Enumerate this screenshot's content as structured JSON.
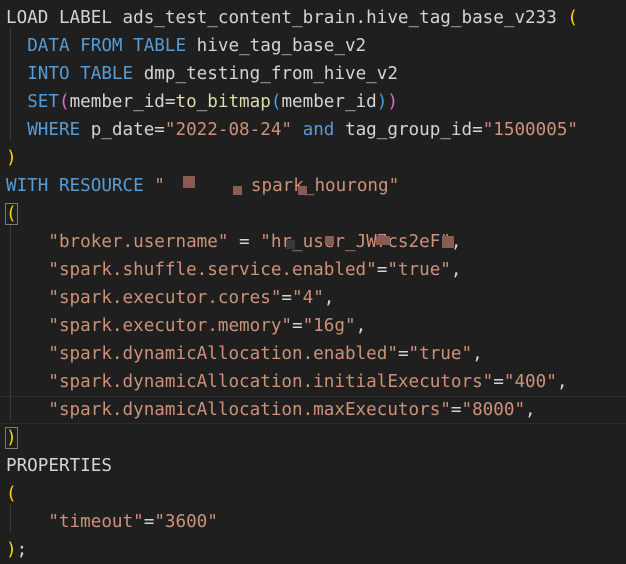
{
  "editor": {
    "line1": {
      "kw": "LOAD LABEL",
      "text": " ads_test_content_brain.hive_tag_base_v233 ",
      "paren": "("
    },
    "line2": {
      "kw": "DATA FROM TABLE",
      "text": " hive_tag_base_v2"
    },
    "line3": {
      "kw": "INTO TABLE",
      "text": " dmp_testing_from_hive_v2"
    },
    "line4": {
      "kw": "SET",
      "paren_open": "(",
      "text1": "member_id=",
      "fn": "to_bitmap",
      "paren_inner_open": "(",
      "text2": "member_id",
      "paren_inner_close": ")",
      "paren_close": ")"
    },
    "line5": {
      "kw": "WHERE",
      "text1": " p_date=",
      "str1": "\"2022-08-24\"",
      "kw2": " and",
      "text2": " tag_group_id=",
      "str2": "\"1500005\""
    },
    "line6": {
      "paren": ")"
    },
    "line7": {
      "kw": "WITH RESOURCE",
      "str": " \"",
      "str_tail": "spark_hourong\""
    },
    "line8": {
      "paren": "("
    },
    "line9": {
      "key": "\"broker.username\"",
      "eq": " = ",
      "val": "\"hr_user_JW7cs2eF\"",
      "comma": ","
    },
    "line10": {
      "key": "\"spark.shuffle.service.enabled\"",
      "eq": "=",
      "val": "\"true\"",
      "comma": ","
    },
    "line11": {
      "key": "\"spark.executor.cores\"",
      "eq": "=",
      "val": "\"4\"",
      "comma": ","
    },
    "line12": {
      "key": "\"spark.executor.memory\"",
      "eq": "=",
      "val": "\"16g\"",
      "comma": ","
    },
    "line13": {
      "key": "\"spark.dynamicAllocation.enabled\"",
      "eq": "=",
      "val": "\"true\"",
      "comma": ","
    },
    "line14": {
      "key": "\"spark.dynamicAllocation.initialExecutors\"",
      "eq": "=",
      "val": "\"400\"",
      "comma": ","
    },
    "line15": {
      "key": "\"spark.dynamicAllocation.maxExecutors\"",
      "eq": "=",
      "val": "\"8000\"",
      "comma": ","
    },
    "line16": {
      "paren": ")"
    },
    "line17": {
      "text": "PROPERTIES"
    },
    "line18": {
      "paren": "("
    },
    "line19": {
      "key": "\"timeout\"",
      "eq": "=",
      "val": "\"3600\""
    },
    "line20": {
      "paren": ")",
      "semi": ";"
    }
  }
}
